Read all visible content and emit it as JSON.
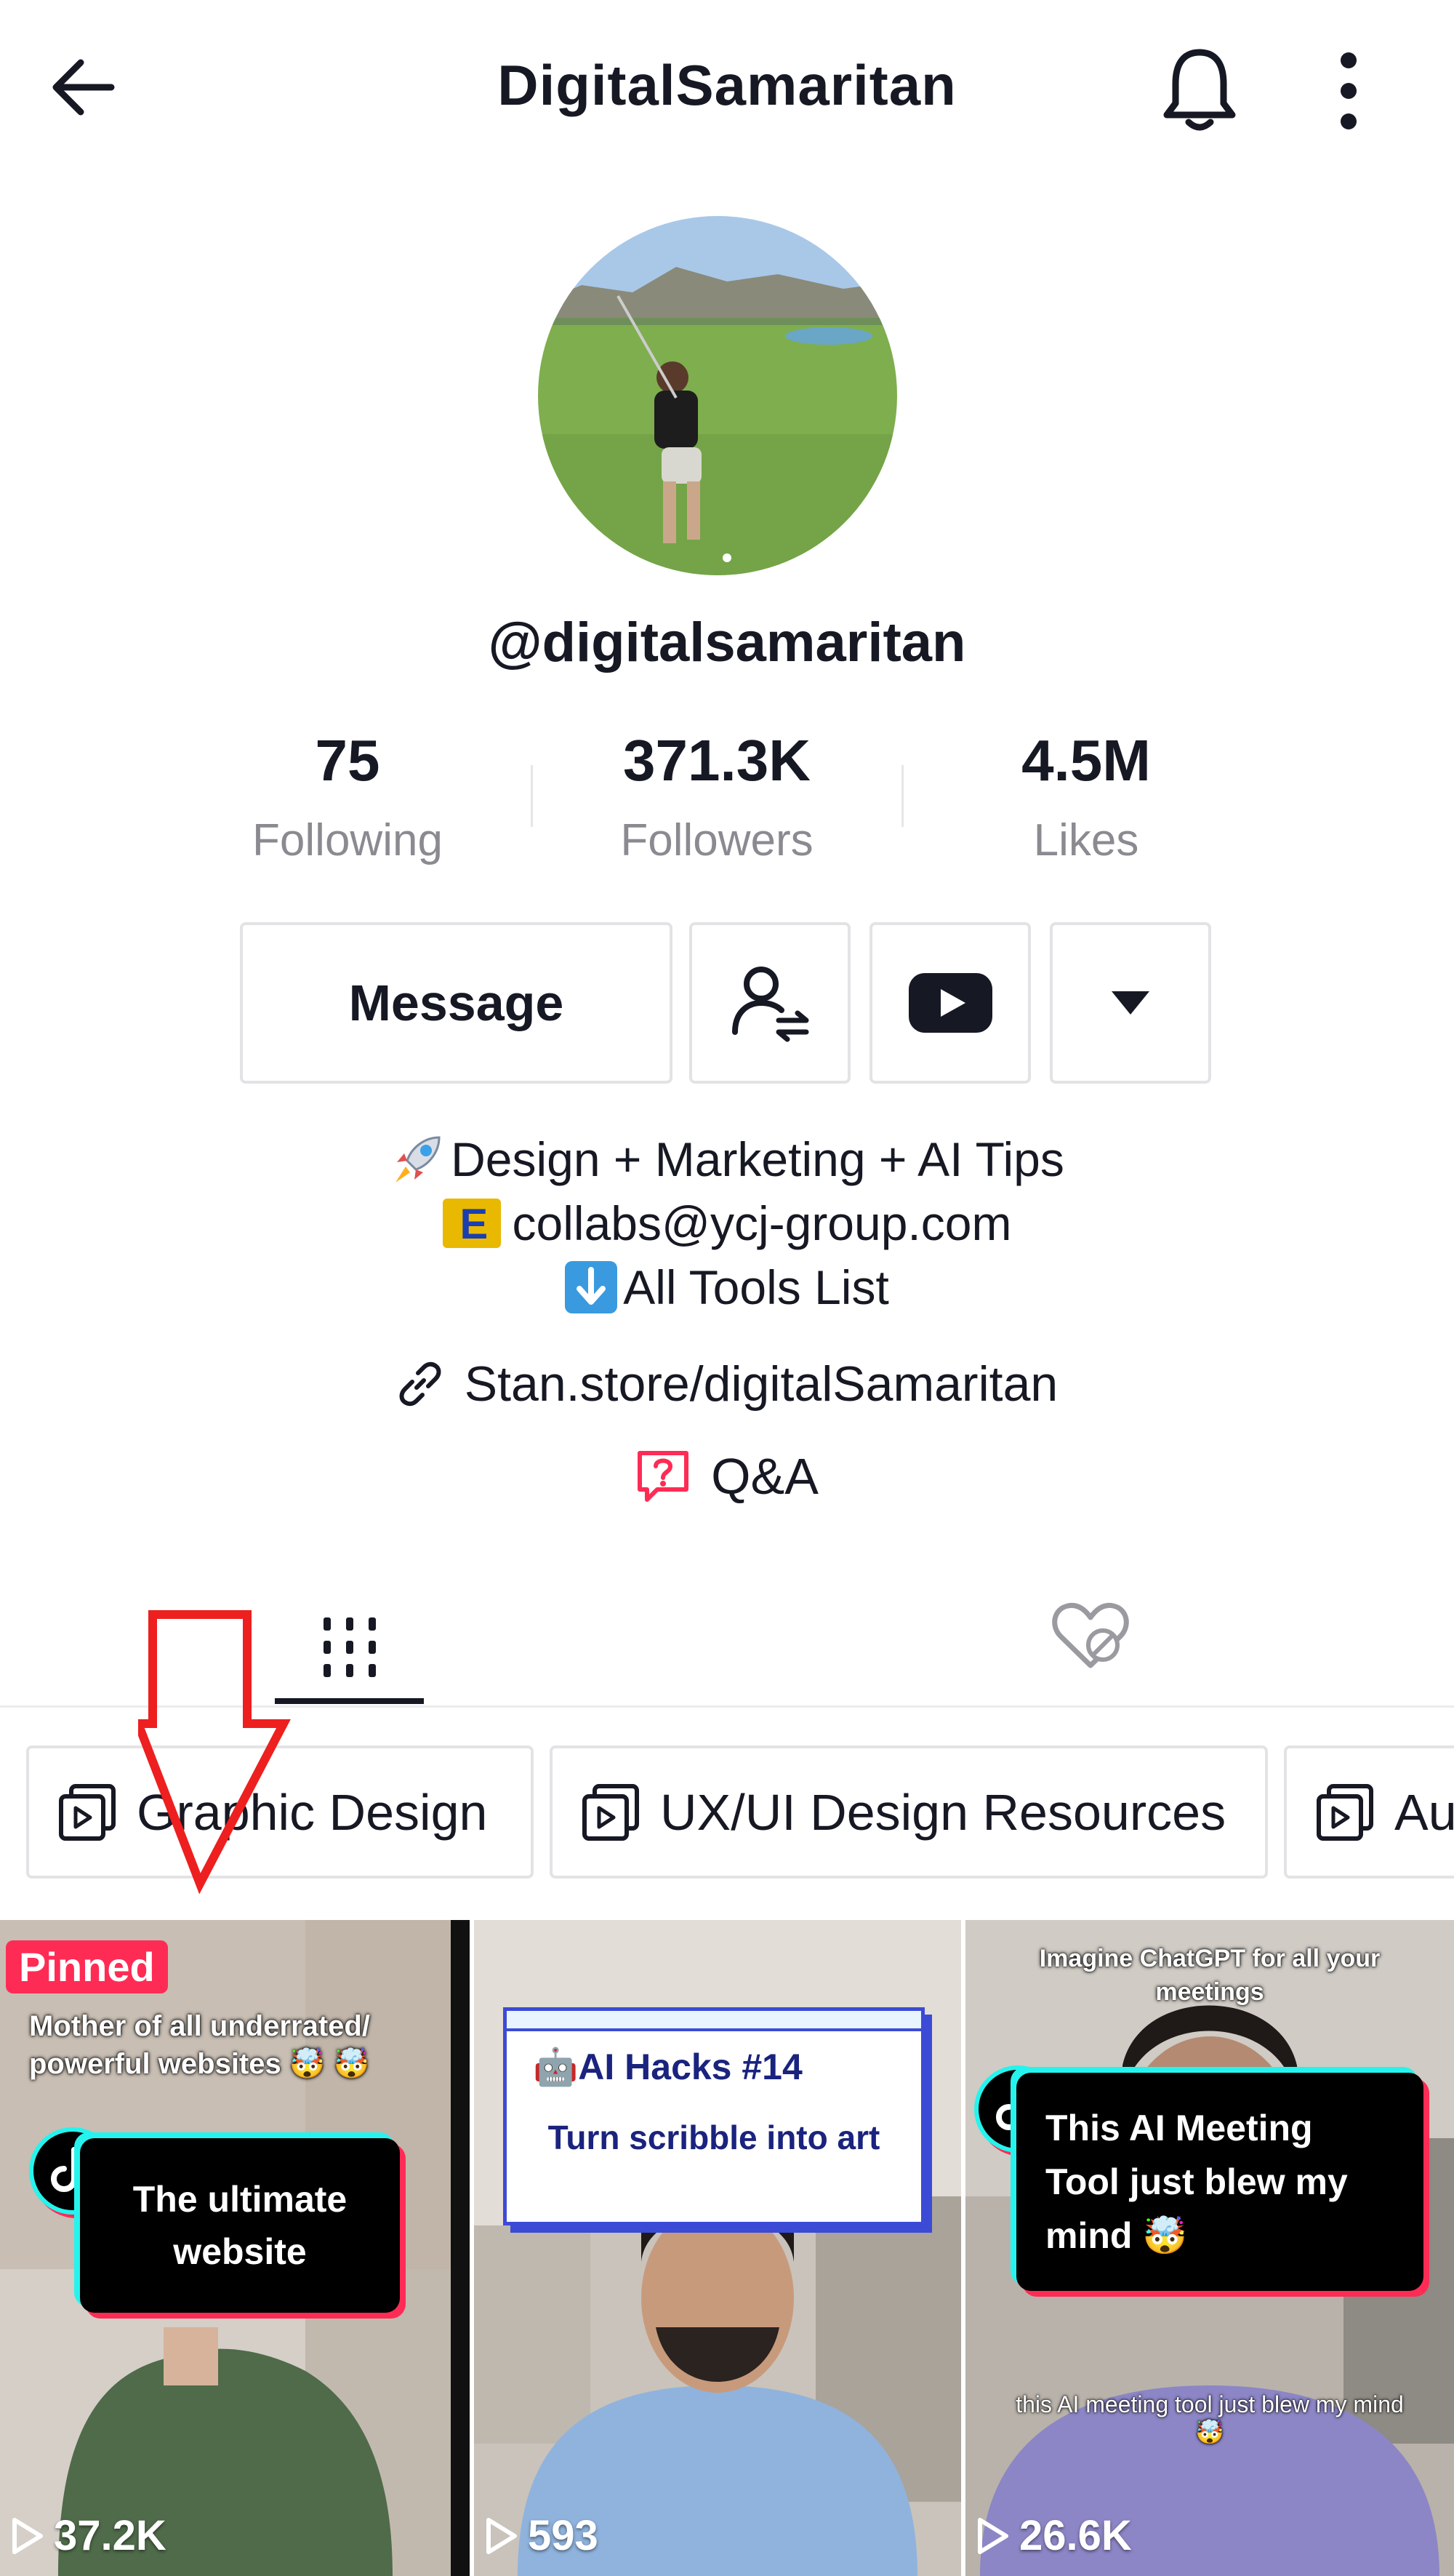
{
  "header": {
    "title": "DigitalSamaritan"
  },
  "profile": {
    "username": "@digitalsamaritan"
  },
  "stats": [
    {
      "value": "75",
      "label": "Following"
    },
    {
      "value": "371.3K",
      "label": "Followers"
    },
    {
      "value": "4.5M",
      "label": "Likes"
    }
  ],
  "actions": {
    "message_label": "Message"
  },
  "bio": {
    "line1": "Design + Marketing + AI Tips",
    "line2": "collabs@ycj-group.com",
    "line3": "All Tools List",
    "link": "Stan.store/digitalSamaritan",
    "qa": "Q&A",
    "e_letter": "E"
  },
  "playlists": [
    {
      "label": "Graphic Design"
    },
    {
      "label": "UX/UI Design Resources"
    },
    {
      "label": "Au"
    }
  ],
  "videos": [
    {
      "pinned_label": "Pinned",
      "caption_top": "Mother of all underrated/ powerful websites 🤯 🤯",
      "card_text": "The ultimate website",
      "views": "37.2K"
    },
    {
      "card_title": "🤖AI Hacks #14",
      "card_sub": "Turn scribble into art",
      "views": "593"
    },
    {
      "caption_top": "Imagine ChatGPT for all your meetings",
      "card_text": "This AI Meeting Tool just blew my mind 🤯",
      "caption_bottom": "this AI meeting tool just blew my mind🤯",
      "views": "26.6K"
    }
  ],
  "icons": {
    "back": "arrow-left-icon",
    "bell": "bell-icon",
    "more": "more-vertical-icon",
    "friends": "person-swap-icon",
    "youtube": "youtube-icon",
    "dropdown": "caret-down-icon",
    "link": "link-icon",
    "qa": "question-bubble-icon",
    "grid": "grid-icon",
    "liked": "heart-hidden-icon",
    "playlist": "playlist-icon",
    "play": "play-outline-icon"
  },
  "colors": {
    "accent_red": "#fe2c55",
    "tiktok_cyan": "#25f4ee",
    "text_primary": "#161823",
    "text_secondary": "#8a8b91"
  }
}
